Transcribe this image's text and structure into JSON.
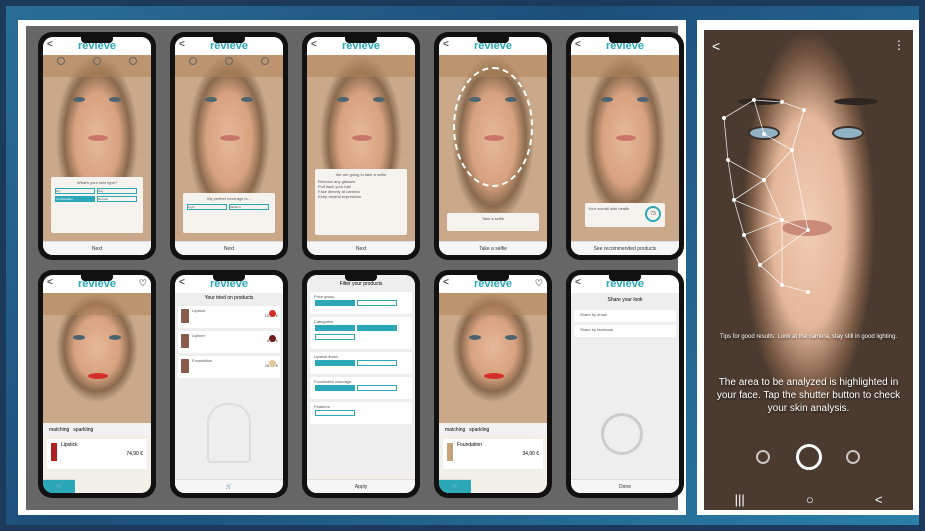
{
  "brand": "revieve",
  "brand_color": "#2aa8b8",
  "phones_row1": [
    {
      "overlay_title": "What's your skin type?",
      "options": [
        "Dry",
        "Oily",
        "Combination",
        "Normal"
      ],
      "button": "Next"
    },
    {
      "overlay_title": "My perfect coverage is...",
      "options": [
        "Light",
        "Medium"
      ],
      "button": "Next"
    },
    {
      "overlay_title": "We are going to take a selfie",
      "options": [
        "Remove any glasses",
        "Pull back your hair",
        "Face directly at camera",
        "Keep neutral expression"
      ],
      "button": "Next"
    },
    {
      "overlay_title": "Take a selfie",
      "button": "Take a selfie"
    },
    {
      "overlay_title": "Your overall skin health",
      "score": "73",
      "button": "See recommended products"
    }
  ],
  "phones_row2": [
    {
      "type": "face",
      "tabs": [
        "matching",
        "sparkling"
      ],
      "product": "Lipstick",
      "price": "74,90 €",
      "color": "#d3302a"
    },
    {
      "type": "list",
      "title": "Your tried on products",
      "items": [
        {
          "name": "Lipstick",
          "price": "15,99 €",
          "color": "#d3302a"
        },
        {
          "name": "Lipliner",
          "price": "8,55 €",
          "color": "#6e1e1e"
        },
        {
          "name": "Foundation",
          "price": "28,90 €",
          "color": "#e5c59b"
        }
      ]
    },
    {
      "type": "filter",
      "title": "Filter your products",
      "sections": [
        "Price group",
        "Categories",
        "Lipstick finish",
        "Foundation coverage",
        "Features"
      ],
      "button": "Apply"
    },
    {
      "type": "face",
      "tabs": [
        "matching",
        "sparkling"
      ],
      "product": "Foundation",
      "price": "34,90 €",
      "color": "#e5c59b"
    },
    {
      "type": "share",
      "title": "Share your look",
      "options": [
        "Share by email",
        "Share by facebook"
      ],
      "button": "Done"
    }
  ],
  "right_photo": {
    "tip_text": "Tips for good results: Look at the camera, stay still in good lighting.",
    "main_text": "The area to be analyzed is highlighted in your face. Tap the shutter button to check your skin analysis.",
    "nav": [
      "|||",
      "○",
      "<"
    ]
  }
}
